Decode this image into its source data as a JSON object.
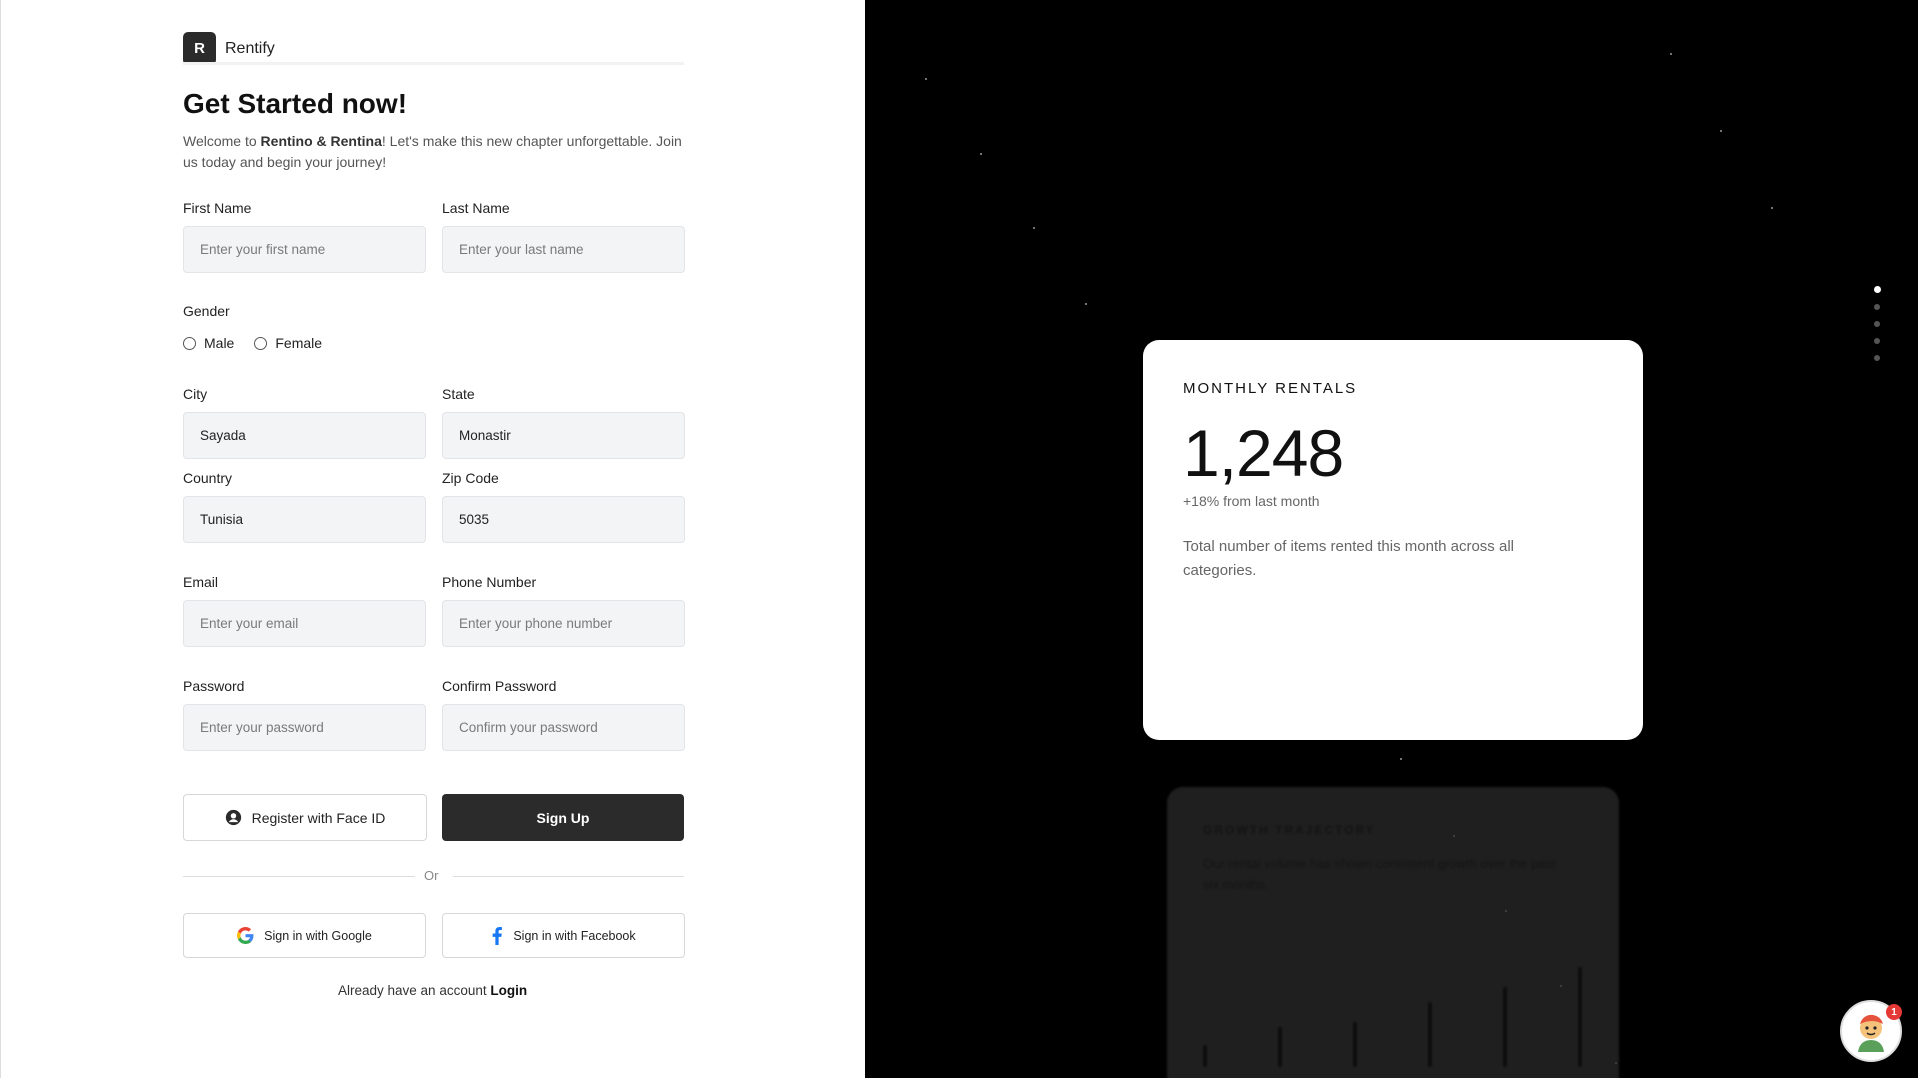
{
  "brand": {
    "logo_letter": "R",
    "name": "Rentify"
  },
  "header": {
    "title": "Get Started now!",
    "subtitle_prefix": "Welcome to ",
    "subtitle_bold": "Rentino & Rentina",
    "subtitle_suffix": "! Let's make this new chapter unforgettable. Join us today and begin your journey!"
  },
  "form": {
    "first_name": {
      "label": "First Name",
      "placeholder": "Enter your first name",
      "value": ""
    },
    "last_name": {
      "label": "Last Name",
      "placeholder": "Enter your last name",
      "value": ""
    },
    "gender": {
      "label": "Gender",
      "options": [
        "Male",
        "Female"
      ]
    },
    "city": {
      "label": "City",
      "value": "Sayada"
    },
    "state": {
      "label": "State",
      "value": "Monastir"
    },
    "country": {
      "label": "Country",
      "value": "Tunisia"
    },
    "zip": {
      "label": "Zip Code",
      "value": "5035"
    },
    "email": {
      "label": "Email",
      "placeholder": "Enter your email",
      "value": ""
    },
    "phone": {
      "label": "Phone Number",
      "placeholder": "Enter your phone number",
      "value": ""
    },
    "password": {
      "label": "Password",
      "placeholder": "Enter your password",
      "value": ""
    },
    "confirm_password": {
      "label": "Confirm Password",
      "placeholder": "Confirm your password",
      "value": ""
    }
  },
  "actions": {
    "face_id": "Register with Face ID",
    "sign_up": "Sign Up",
    "or": "Or",
    "google": "Sign in with Google",
    "facebook": "Sign in with Facebook",
    "login_prompt": "Already have an account",
    "login_link": "Login"
  },
  "showcase": {
    "card": {
      "eyebrow": "MONTHLY RENTALS",
      "value": "1,248",
      "change": "+18% from last month",
      "description": "Total number of items rented this month across all categories."
    },
    "next_card": {
      "eyebrow": "GROWTH TRAJECTORY",
      "description": "Our rental volume has shown consistent growth over the past six months."
    },
    "slide_count": 5,
    "active_slide": 1
  },
  "assistant": {
    "badge_count": "1"
  },
  "colors": {
    "primary_dark": "#2b2b2b",
    "input_bg": "#f3f4f6",
    "showcase_bg": "#000000",
    "google_blue": "#4285F4",
    "facebook_blue": "#1877F2",
    "badge_red": "#e53935"
  }
}
